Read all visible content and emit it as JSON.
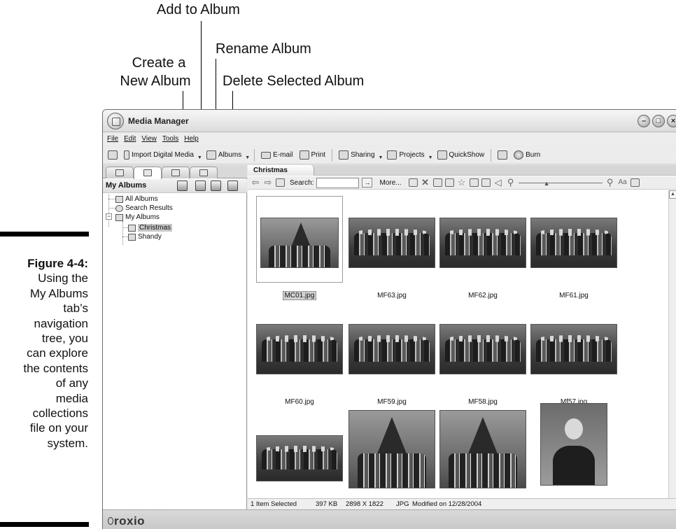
{
  "callouts": {
    "add_to_album": "Add to Album",
    "rename_album": "Rename Album",
    "create_album_line1": "Create a",
    "create_album_line2": "New Album",
    "delete_album": "Delete Selected Album"
  },
  "caption": {
    "figure": "Figure 4-4:",
    "lines": [
      "Using the",
      "My Albums",
      "tab’s",
      "navigation",
      "tree, you",
      "can explore",
      "the contents",
      "of any",
      "media",
      "collections",
      "file on your",
      "system."
    ]
  },
  "window": {
    "title": "Media Manager",
    "controls": [
      "–",
      "□",
      "×"
    ]
  },
  "menu": [
    "File",
    "Edit",
    "View",
    "Tools",
    "Help"
  ],
  "toolbar": {
    "import": "Import Digital Media",
    "albums": "Albums",
    "email": "E-mail",
    "print": "Print",
    "sharing": "Sharing",
    "projects": "Projects",
    "quickshow": "QuickShow",
    "burn": "Burn"
  },
  "left_pane": {
    "header": "My Albums",
    "tree": {
      "all_albums": "All Albums",
      "search_results": "Search Results",
      "my_albums": "My Albums",
      "christmas": "Christmas",
      "shandy": "Shandy"
    }
  },
  "right_pane": {
    "breadcrumb": "Christmas",
    "search_label": "Search:",
    "search_value": "",
    "more_label": "More...",
    "files": [
      {
        "name": "MC01.jpg",
        "kind": "tree",
        "selected": true
      },
      {
        "name": "MF63.jpg",
        "kind": "group"
      },
      {
        "name": "MF62.jpg",
        "kind": "group"
      },
      {
        "name": "MF61.jpg",
        "kind": "group"
      },
      {
        "name": "MF60.jpg",
        "kind": "group"
      },
      {
        "name": "MF59.jpg",
        "kind": "group"
      },
      {
        "name": "MF58.jpg",
        "kind": "group"
      },
      {
        "name": "Mf57.jpg",
        "kind": "group"
      },
      {
        "name": "",
        "kind": "group"
      },
      {
        "name": "",
        "kind": "tree"
      },
      {
        "name": "",
        "kind": "tree"
      },
      {
        "name": "",
        "kind": "portrait"
      }
    ]
  },
  "status": {
    "selected": "1 Item Selected",
    "size": "397 KB",
    "dimensions": "2898 X 1822",
    "type": "JPG",
    "modified": "Modified on 12/28/2004"
  },
  "footer": {
    "brand": "roxio"
  },
  "colors": {
    "selection": "#c7c7c7",
    "window_bg": "#e9e9e9"
  }
}
